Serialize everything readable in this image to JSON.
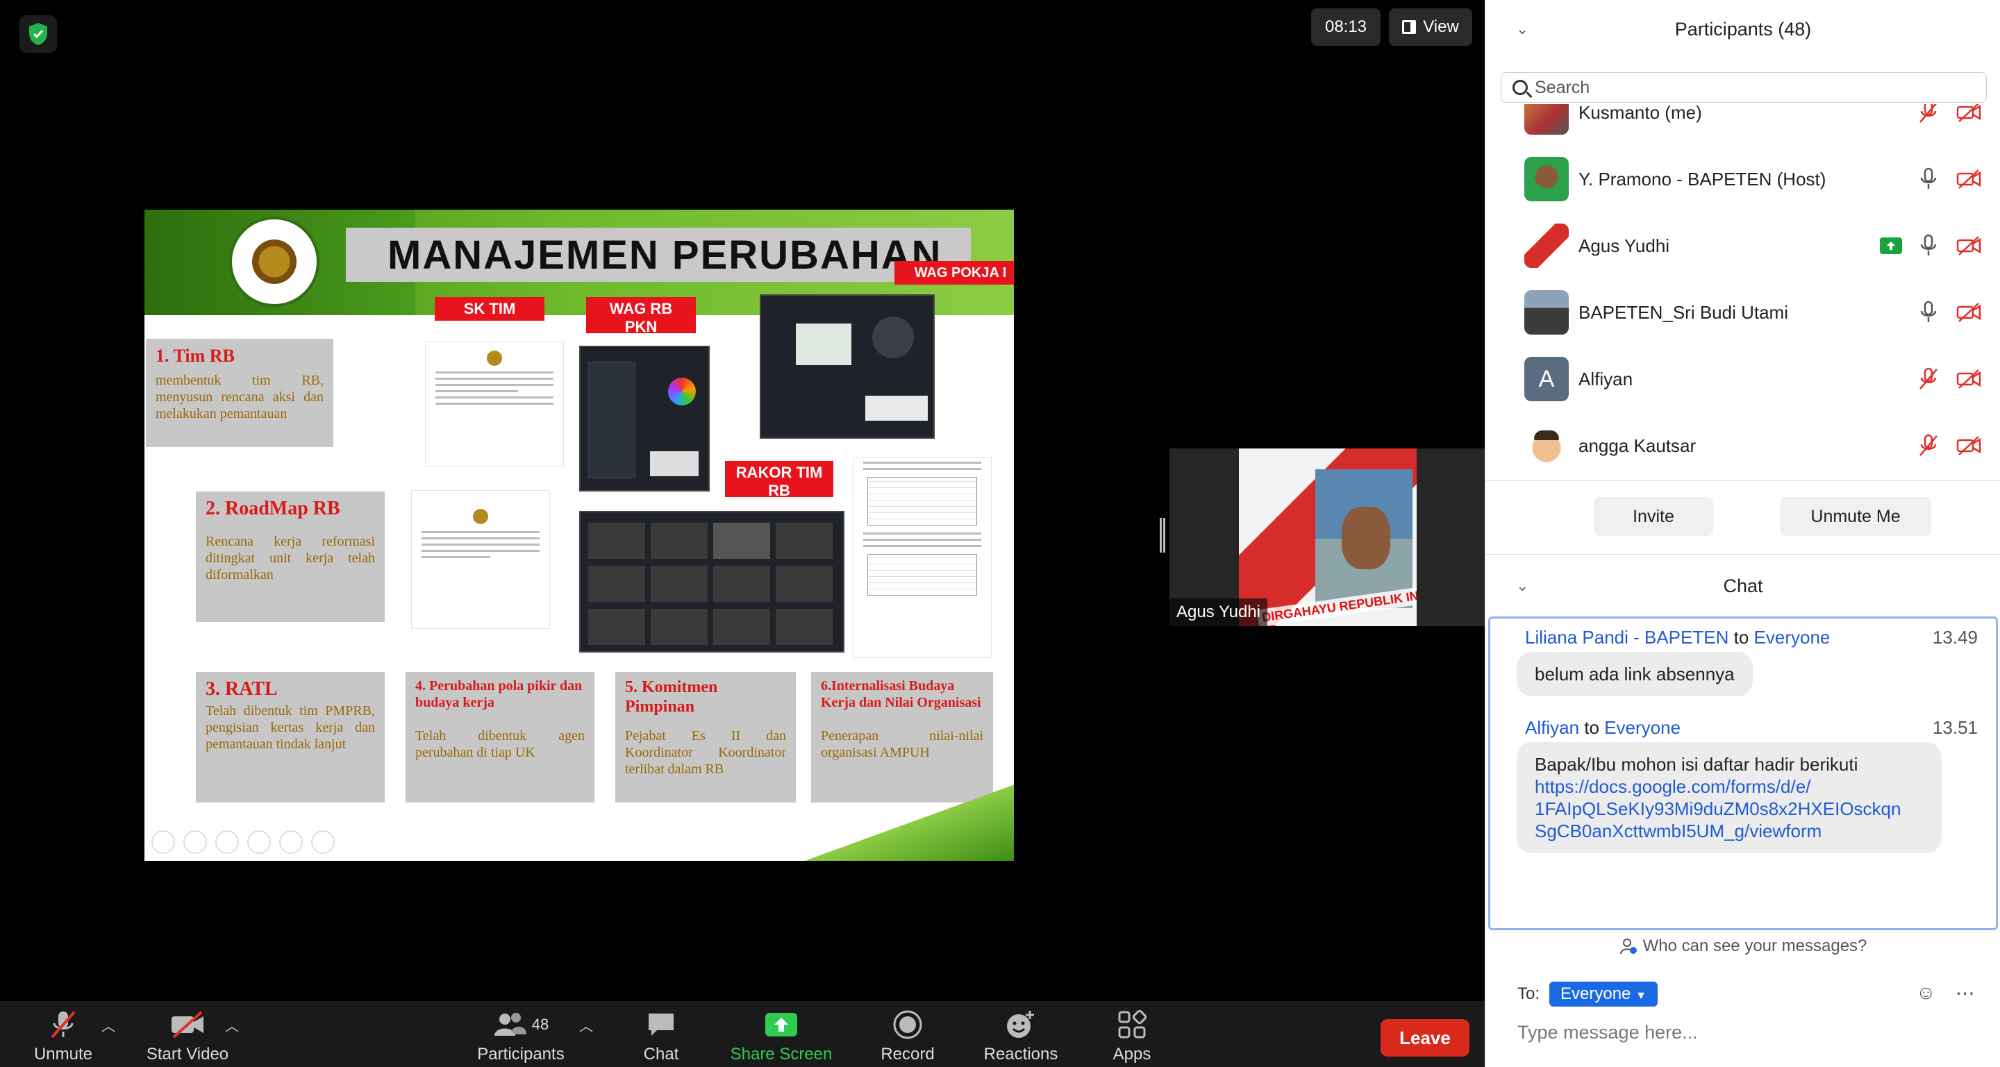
{
  "meeting": {
    "timer": "08:13",
    "view_label": "View",
    "self_view": {
      "name": "Agus Yudhi",
      "photo_caption": "DIRGAHAYU REPUBLIK INDONESIA"
    }
  },
  "slide": {
    "title": "MANAJEMEN PERUBAHAN",
    "tags": {
      "sk_tim": "SK TIM",
      "wag_rb": "WAG RB PKN",
      "wag_pokja": "WAG POKJA I",
      "rakor": "RAKOR TIM RB"
    },
    "boxes": [
      {
        "title": "1. Tim RB",
        "body": "membentuk tim RB, menyusun rencana aksi dan melakukan pemantauan"
      },
      {
        "title": "2. RoadMap RB",
        "body": "Rencana kerja reformasi ditingkat unit kerja telah diformalkan"
      },
      {
        "title": "3. RATL",
        "body": "Telah dibentuk tim PMPRB, pengisian kertas kerja dan pemantauan tindak lanjut"
      },
      {
        "title": "4. Perubahan pola pikir dan budaya kerja",
        "body": "Telah dibentuk agen perubahan di tiap UK"
      },
      {
        "title": "5. Komitmen Pimpinan",
        "body": "Pejabat Es II dan Koordinator Koordinator terlibat dalam RB"
      },
      {
        "title": "6.Internalisasi Budaya Kerja dan Nilai Organisasi",
        "body": "Penerapan nilai-nilai organisasi AMPUH"
      }
    ]
  },
  "toolbar": {
    "unmute": "Unmute",
    "start_video": "Start Video",
    "participants": "Participants",
    "participants_count": "48",
    "chat": "Chat",
    "share_screen": "Share Screen",
    "record": "Record",
    "reactions": "Reactions",
    "apps": "Apps",
    "leave": "Leave"
  },
  "participants_panel": {
    "title": "Participants (48)",
    "search_placeholder": "Search",
    "people": [
      {
        "name": "Kusmanto (me)",
        "avatar": "photo",
        "mic": "muted",
        "video": "off"
      },
      {
        "name": "Y. Pramono - BAPETEN (Host)",
        "avatar": "photo",
        "mic": "on",
        "video": "off"
      },
      {
        "name": "Agus Yudhi",
        "avatar": "photo",
        "mic": "on",
        "video": "off",
        "sharing": true
      },
      {
        "name": "BAPETEN_Sri Budi Utami",
        "avatar": "photo",
        "mic": "on",
        "video": "off"
      },
      {
        "name": "Alfiyan",
        "avatar": "A",
        "mic": "muted",
        "video": "off"
      },
      {
        "name": "angga Kautsar",
        "avatar": "photo",
        "mic": "muted",
        "video": "off"
      }
    ],
    "invite": "Invite",
    "unmute_me": "Unmute Me"
  },
  "chat_panel": {
    "title": "Chat",
    "messages": [
      {
        "sender": "Liliana Pandi - BAPETEN",
        "to_word": "to",
        "recipient": "Everyone",
        "time": "13.49",
        "lines": [
          "belum ada link absennya"
        ]
      },
      {
        "sender": "Alfiyan",
        "to_word": "to",
        "recipient": "Everyone",
        "time": "13.51",
        "text": "Bapak/Ibu mohon isi daftar hadir berikuti",
        "link_lines": [
          "https://docs.google.com/forms/d/e/",
          "1FAIpQLSeKIy93Mi9duZM0s8x2HXEIOsckqn",
          "SgCB0anXcttwmbI5UM_g/viewform"
        ]
      }
    ],
    "who_can_see": "Who can see your messages?",
    "to_label": "To:",
    "to_value": "Everyone",
    "input_placeholder": "Type message here..."
  },
  "colors": {
    "accent_blue": "#1f5bd4",
    "leave_red": "#d9281c",
    "share_green": "#2fcc51",
    "muted_red": "#e0302a"
  }
}
